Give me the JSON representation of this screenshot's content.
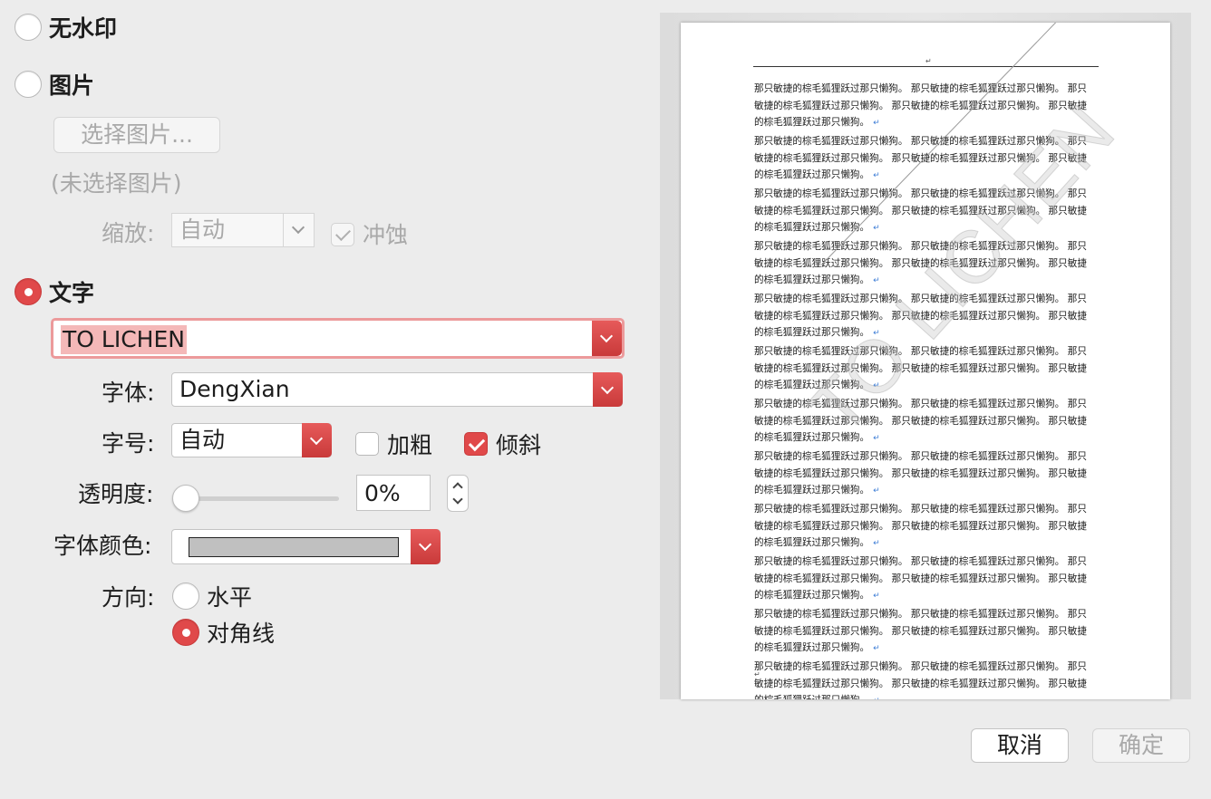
{
  "options": {
    "none_label": "无水印",
    "picture_label": "图片",
    "select_picture_button": "选择图片...",
    "no_picture_selected": "(未选择图片)",
    "scale_label": "缩放:",
    "scale_value": "自动",
    "washout_label": "冲蚀",
    "text_label": "文字"
  },
  "text_settings": {
    "text_value": "TO LICHEN",
    "font_label": "字体:",
    "font_value": "DengXian",
    "size_label": "字号:",
    "size_value": "自动",
    "bold_label": "加粗",
    "italic_label": "倾斜",
    "transparency_label": "透明度:",
    "transparency_value": "0%",
    "transparency_fraction": 0.0,
    "color_label": "字体颜色:",
    "color_value": "#c0c0c0",
    "direction_label": "方向:",
    "horizontal_label": "水平",
    "diagonal_label": "对角线"
  },
  "state": {
    "selected_option": "text",
    "bold_checked": false,
    "italic_checked": true,
    "washout_checked": true,
    "direction": "diagonal"
  },
  "preview": {
    "header_mark": "↵",
    "watermark_text": "TO LICHEN",
    "paragraph_lines": [
      "那只敏捷的棕毛狐狸跃过那只懒狗。 那只敏捷的棕毛狐狸跃过那只懒狗。 那只",
      "敏捷的棕毛狐狸跃过那只懒狗。 那只敏捷的棕毛狐狸跃过那只懒狗。 那只敏捷",
      "的棕毛狐狸跃过那只懒狗。"
    ],
    "paragraph_mark": "↵",
    "end_mark": "↵"
  },
  "buttons": {
    "cancel": "取消",
    "ok": "确定"
  },
  "colors": {
    "accent": "#e0494a",
    "selection_highlight": "#f4b8b8",
    "background": "#ececec"
  }
}
